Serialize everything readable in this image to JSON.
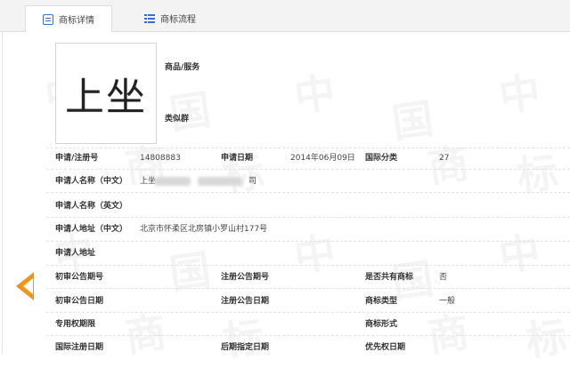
{
  "tabs": [
    {
      "label": "商标详情",
      "icon": "document-icon",
      "active": true
    },
    {
      "label": "商标流程",
      "icon": "list-icon",
      "active": false
    }
  ],
  "trademark": {
    "image_text": "上坐",
    "goods_label": "商品/服务",
    "similar_label": "类似群"
  },
  "fields": {
    "reg_no_label": "申请/注册号",
    "reg_no_value": "14808883",
    "apply_date_label": "申请日期",
    "apply_date_value": "2014年06月09日",
    "intl_class_label": "国际分类",
    "intl_class_value": "27",
    "applicant_cn_label": "申请人名称（中文）",
    "applicant_cn_prefix": "上坐",
    "applicant_cn_suffix": "司",
    "applicant_en_label": "申请人名称（英文）",
    "address_cn_label": "申请人地址（中文）",
    "address_cn_value": "北京市怀柔区北房镇小罗山村177号",
    "address_en_label": "申请人地址",
    "prelim_no_label": "初审公告期号",
    "reg_pub_no_label": "注册公告期号",
    "shared_label": "是否共有商标",
    "shared_value": "否",
    "prelim_date_label": "初审公告日期",
    "reg_pub_date_label": "注册公告日期",
    "tm_type_label": "商标类型",
    "tm_type_value": "一般",
    "exclusive_label": "专用权期限",
    "tm_form_label": "商标形式",
    "intl_reg_date_label": "国际注册日期",
    "later_date_label": "后期指定日期",
    "priority_date_label": "优先权日期"
  },
  "colors": {
    "accent_arrow": "#f29418",
    "tab_icon": "#3a6fc8"
  }
}
